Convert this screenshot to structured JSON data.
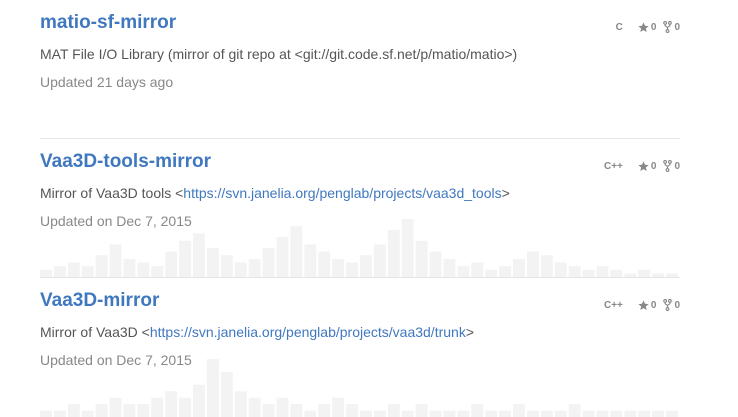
{
  "repos": [
    {
      "name": "matio-sf-mirror",
      "description": "MAT File I/O Library (mirror of git repo at <git://git.code.sf.net/p/matio/matio>)",
      "updated": "Updated 21 days ago",
      "language": "C",
      "stars": "0",
      "forks": "0",
      "activity": []
    },
    {
      "name": "Vaa3D-tools-mirror",
      "description_prefix": "Mirror of Vaa3D tools <",
      "link": "https://svn.janelia.org/penglab/projects/vaa3d_tools",
      "description_suffix": ">",
      "updated": "Updated on Dec 7, 2015",
      "language": "C++",
      "stars": "0",
      "forks": "0",
      "activity": [
        2,
        3,
        4,
        3,
        6,
        9,
        5,
        4,
        3,
        7,
        10,
        12,
        8,
        6,
        4,
        5,
        8,
        11,
        14,
        9,
        7,
        5,
        4,
        6,
        9,
        13,
        16,
        10,
        7,
        5,
        3,
        4,
        2,
        3,
        5,
        7,
        6,
        4,
        3,
        2,
        3,
        2,
        1,
        2,
        1,
        1
      ]
    },
    {
      "name": "Vaa3D-mirror",
      "description_prefix": "Mirror of Vaa3D <",
      "link": "https://svn.janelia.org/penglab/projects/vaa3d/trunk",
      "description_suffix": ">",
      "updated": "Updated on Dec 7, 2015",
      "language": "C++",
      "stars": "0",
      "forks": "0",
      "activity": [
        1,
        1,
        2,
        1,
        2,
        3,
        2,
        2,
        3,
        4,
        3,
        5,
        9,
        7,
        4,
        3,
        2,
        3,
        2,
        1,
        2,
        3,
        2,
        1,
        1,
        2,
        1,
        2,
        1,
        1,
        1,
        2,
        1,
        1,
        2,
        1,
        1,
        1,
        2,
        1,
        1,
        1,
        1,
        1,
        1,
        1
      ]
    }
  ],
  "colors": {
    "link": "#4078c0",
    "muted": "#888888",
    "spark": "#f3f3f3"
  }
}
